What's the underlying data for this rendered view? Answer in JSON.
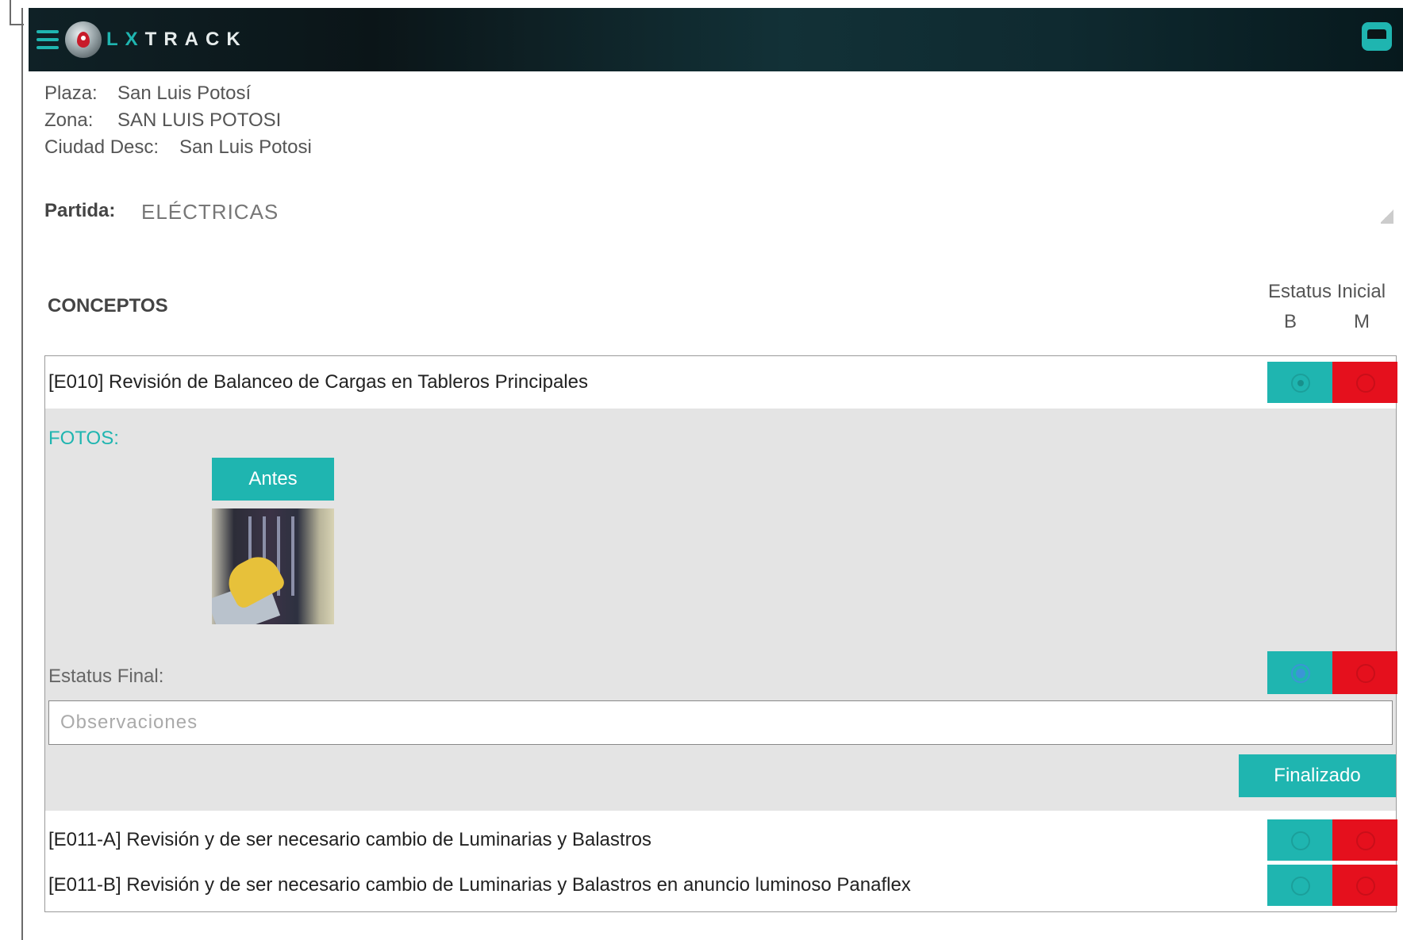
{
  "app": {
    "brand_prefix": "LX",
    "brand_suffix": "TRACK",
    "accent_color": "#1fb5b0",
    "danger_color": "#e5101d"
  },
  "info": {
    "plaza_label": "Plaza:",
    "plaza_value": "San Luis Potosí",
    "zona_label": "Zona:",
    "zona_value": "SAN LUIS POTOSI",
    "ciudad_label": "Ciudad Desc:",
    "ciudad_value": "San Luis Potosi"
  },
  "partida": {
    "label": "Partida:",
    "value": "ELÉCTRICAS"
  },
  "table": {
    "section_title": "CONCEPTOS",
    "status_header": "Estatus Inicial",
    "col_b": "B",
    "col_m": "M"
  },
  "concepts": [
    {
      "text": "[E010] Revisión de Balanceo de Cargas en Tableros Principales",
      "expanded": true
    },
    {
      "text": "[E011-A] Revisión y de ser necesario cambio de Luminarias y Balastros",
      "expanded": false
    },
    {
      "text": "[E011-B] Revisión y de ser necesario cambio de Luminarias y Balastros en anuncio luminoso Panaflex",
      "expanded": false
    }
  ],
  "detail": {
    "fotos_label": "FOTOS:",
    "antes_button": "Antes",
    "estatus_final_label": "Estatus Final:",
    "observaciones_placeholder": "Observaciones",
    "observaciones_value": "",
    "finalizado_button": "Finalizado"
  }
}
